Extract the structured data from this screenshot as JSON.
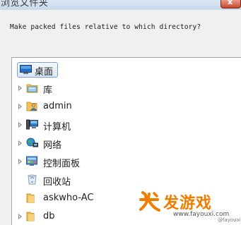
{
  "window": {
    "title": "浏览文件夹",
    "close_label": "x"
  },
  "prompt": "Make packed files relative to which directory?",
  "tree": {
    "items": [
      {
        "label": "桌面",
        "icon": "desktop-icon",
        "selected": true,
        "expandable": false
      },
      {
        "label": "库",
        "icon": "libraries-icon",
        "selected": false,
        "expandable": true
      },
      {
        "label": "admin",
        "icon": "user-folder-icon",
        "selected": false,
        "expandable": true
      },
      {
        "label": "计算机",
        "icon": "computer-icon",
        "selected": false,
        "expandable": true
      },
      {
        "label": "网络",
        "icon": "network-icon",
        "selected": false,
        "expandable": true
      },
      {
        "label": "控制面板",
        "icon": "control-panel-icon",
        "selected": false,
        "expandable": true
      },
      {
        "label": "回收站",
        "icon": "recycle-bin-icon",
        "selected": false,
        "expandable": false
      },
      {
        "label": "askwho-AC",
        "icon": "folder-icon",
        "selected": false,
        "expandable": false
      },
      {
        "label": "db",
        "icon": "folder-icon",
        "selected": false,
        "expandable": true
      }
    ]
  },
  "watermark": {
    "brand": "发游戏",
    "url": "www.fayouxi.com",
    "url_secondary": "@fayouxi"
  },
  "colors": {
    "selection_border": "#7da2ce",
    "selection_fill": "#dbe8f8",
    "folder": "#f3c35a",
    "watermark_orange": "#f07d00"
  }
}
